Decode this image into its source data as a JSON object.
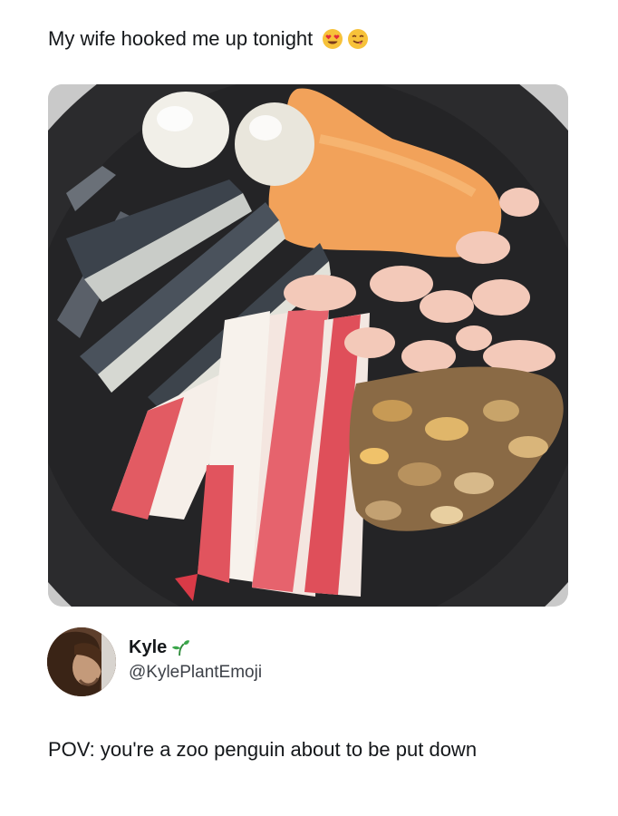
{
  "post": {
    "caption": "My wife hooked me up tonight",
    "caption_emojis": [
      "heart-eyes-emoji",
      "yum-emoji"
    ]
  },
  "photo": {
    "subject_icon": "seafood-plate-photo",
    "colors": {
      "plate": "#2b2b2d",
      "sauce": "#f2a25a",
      "crab_stick_red": "#e1545e",
      "shrimp": "#f3c9b9",
      "clams": "#b58a52",
      "sardine": "#454c56"
    }
  },
  "author": {
    "display_name": "Kyle",
    "badge_icon": "seedling-icon",
    "handle": "@KylePlantEmoji"
  },
  "tweet": {
    "text": "POV: you're a zoo penguin about to be put down"
  }
}
